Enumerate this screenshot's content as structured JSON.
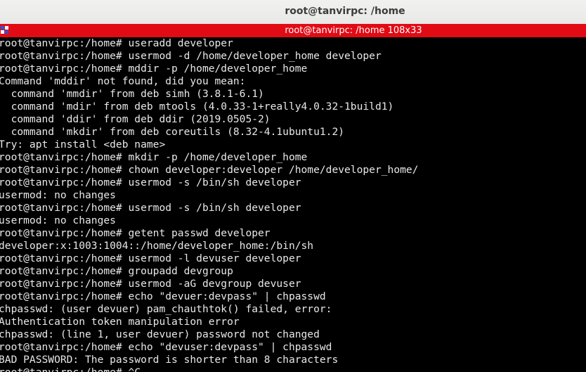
{
  "window": {
    "title": "root@tanvirpc: /home"
  },
  "tab": {
    "title": "root@tanvirpc: /home 108x33"
  },
  "terminal": {
    "lines": [
      "root@tanvirpc:/home# useradd developer",
      "root@tanvirpc:/home# usermod -d /home/developer_home developer",
      "root@tanvirpc:/home# mddir -p /home/developer_home",
      "Command 'mddir' not found, did you mean:",
      "  command 'mmdir' from deb simh (3.8.1-6.1)",
      "  command 'mdir' from deb mtools (4.0.33-1+really4.0.32-1build1)",
      "  command 'ddir' from deb ddir (2019.0505-2)",
      "  command 'mkdir' from deb coreutils (8.32-4.1ubuntu1.2)",
      "Try: apt install <deb name>",
      "root@tanvirpc:/home# mkdir -p /home/developer_home",
      "root@tanvirpc:/home# chown developer:developer /home/developer_home/",
      "root@tanvirpc:/home# usermod -s /bin/sh developer",
      "usermod: no changes",
      "root@tanvirpc:/home# usermod -s /bin/sh developer",
      "usermod: no changes",
      "root@tanvirpc:/home# getent passwd developer",
      "developer:x:1003:1004::/home/developer_home:/bin/sh",
      "root@tanvirpc:/home# usermod -l devuser developer",
      "root@tanvirpc:/home# groupadd devgroup",
      "root@tanvirpc:/home# usermod -aG devgroup devuser",
      "root@tanvirpc:/home# echo \"devuer:devpass\" | chpasswd",
      "chpasswd: (user devuer) pam_chauthtok() failed, error:",
      "Authentication token manipulation error",
      "chpasswd: (line 1, user devuer) password not changed",
      "root@tanvirpc:/home# echo \"devuser:devpass\" | chpasswd",
      "BAD PASSWORD: The password is shorter than 8 characters",
      "root@tanvirpc:/home# ^C"
    ]
  },
  "colors": {
    "titlebar_bg": "#f1f1f0",
    "tabbar_bg": "#e10b15",
    "terminal_bg": "#000000",
    "terminal_fg": "#e8e8e8"
  }
}
